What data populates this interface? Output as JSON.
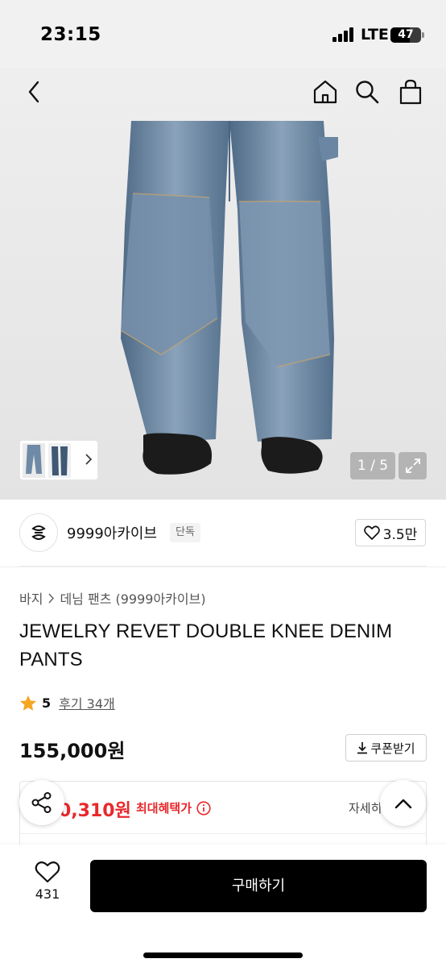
{
  "status_bar": {
    "time": "23:15",
    "network": "LTE",
    "battery": "47"
  },
  "nav": {
    "back_icon": "chevron-left-icon",
    "home_icon": "home-icon",
    "search_icon": "search-icon",
    "bag_icon": "shopping-bag-icon"
  },
  "gallery": {
    "page_indicator": "1 / 5"
  },
  "seller": {
    "name": "9999아카이브",
    "badge": "단독",
    "likes": "3.5만"
  },
  "breadcrumb": {
    "level1": "바지",
    "level2": "데님 팬츠 (9999아카이브)"
  },
  "product": {
    "title": "JEWELRY REVET DOUBLE KNEE DENIM PANTS",
    "rating": "5",
    "reviews": "후기 34개",
    "price": "155,000원"
  },
  "coupon": {
    "label": "쿠폰받기"
  },
  "benefit": {
    "price": "0,310원",
    "label": "최대혜택가",
    "detail": "자세히"
  },
  "bottom_bar": {
    "wish_count": "431",
    "buy_label": "구매하기"
  },
  "colors": {
    "accent": "#e8282b",
    "star": "#f5a623",
    "button": "#000000"
  }
}
